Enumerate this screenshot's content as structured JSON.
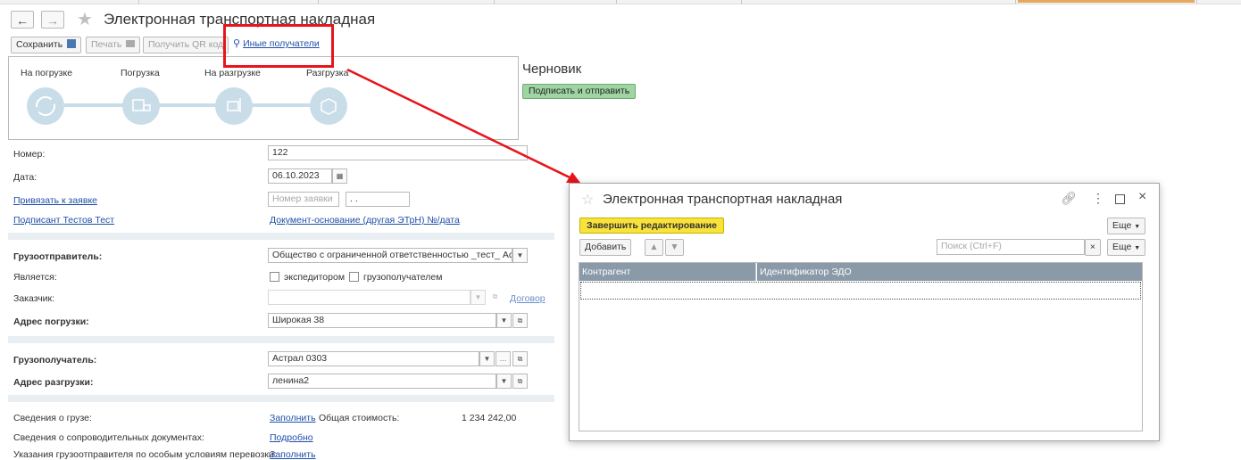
{
  "window": {
    "title": "Электронная транспортная накладная",
    "back_icon": "arrow-left-icon",
    "forward_icon": "arrow-right-icon",
    "favorite_icon": "star-icon"
  },
  "toolbar": {
    "save_label": "Сохранить",
    "print_label": "Печать",
    "qr_label": "Получить QR код",
    "other_recipients_label": "Иные получатели"
  },
  "status": {
    "text": "Черновик",
    "sign_button": "Подписать и отправить"
  },
  "stages": [
    {
      "label": "На погрузке",
      "icon": "refresh-icon"
    },
    {
      "label": "Погрузка",
      "icon": "loading-icon"
    },
    {
      "label": "На разгрузке",
      "icon": "forklift-icon"
    },
    {
      "label": "Разгрузка",
      "icon": "box-icon"
    }
  ],
  "form": {
    "number_label": "Номер:",
    "number_value": "122",
    "date_label": "Дата:",
    "date_value": "06.10.2023",
    "bind_link": "Привязать к заявке",
    "request_placeholder": "Номер заявки",
    "request_date": ". .",
    "signer_link": "Подписант Тестов Тест",
    "basis_link": "Документ-основание (другая ЭТрН) №/дата",
    "shipper_label": "Грузоотправитель:",
    "shipper_value": "Общество с ограниченной ответственностью _тест_ Астрал",
    "is_label": "Является:",
    "forwarder_label": "экспедитором",
    "consignee_cb_label": "грузополучателем",
    "customer_label": "Заказчик:",
    "contract_link": "Договор",
    "load_addr_label": "Адрес погрузки:",
    "load_addr_value": "Широкая 38",
    "consignee_label": "Грузополучатель:",
    "consignee_value": "Астрал 0303",
    "unload_addr_label": "Адрес разгрузки:",
    "unload_addr_value": "ленина2",
    "cargo_label": "Сведения о грузе:",
    "fill_link": "Заполнить",
    "total_label": "Общая стоимость:",
    "total_value": "1 234 242,00",
    "docs_label": "Сведения о сопроводительных документах:",
    "details_link": "Подробно",
    "instructions_label": "Указания грузоотправителя по особым условиям перевозки:",
    "fill_link2": "Заполнить"
  },
  "dialog": {
    "title": "Электронная транспортная накладная",
    "finish_button": "Завершить редактирование",
    "more_label": "Еще",
    "add_button": "Добавить",
    "search_placeholder": "Поиск (Ctrl+F)",
    "clear_label": "×",
    "more_label2": "Еще",
    "columns": [
      "Контрагент",
      "Идентификатор ЭДО"
    ]
  },
  "colors": {
    "highlight_box": "#e8141b",
    "arrow": "#e8141b",
    "accent_yellow": "#f8e33b",
    "accent_green": "#9fd4a3",
    "stage_circle": "#c9dde9",
    "table_header": "#8a9aa8"
  }
}
